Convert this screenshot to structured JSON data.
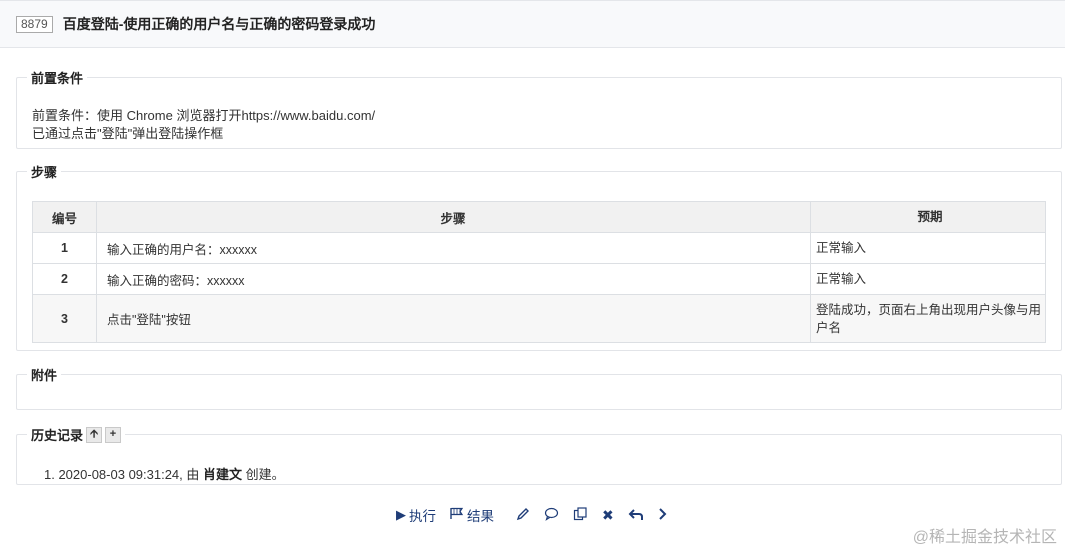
{
  "header": {
    "id": "8879",
    "title": "百度登陆-使用正确的用户名与正确的密码登录成功"
  },
  "preconditions": {
    "legend": "前置条件",
    "line1": "前置条件：使用 Chrome 浏览器打开https://www.baidu.com/",
    "line2": "已通过点击\"登陆\"弹出登陆操作框"
  },
  "steps": {
    "legend": "步骤",
    "headers": {
      "num": "编号",
      "step": "步骤",
      "expect": "预期"
    },
    "rows": [
      {
        "num": "1",
        "step": "输入正确的用户名：xxxxxx",
        "expect": "正常输入"
      },
      {
        "num": "2",
        "step": "输入正确的密码：xxxxxx",
        "expect": "正常输入"
      },
      {
        "num": "3",
        "step": "点击\"登陆\"按钮",
        "expect": "登陆成功，页面右上角出现用户头像与用户名"
      }
    ]
  },
  "attachments": {
    "legend": "附件"
  },
  "history": {
    "legend": "历史记录",
    "item_prefix": "1. 2020-08-03 09:31:24, 由 ",
    "item_user": "肖建文",
    "item_suffix": " 创建。"
  },
  "actions": {
    "execute": "执行",
    "result": "结果"
  },
  "icons": {
    "execute": "play-icon",
    "result": "flag-icon",
    "edit": "pencil-icon",
    "comment": "comment-icon",
    "copy": "copy-icon",
    "delete": "close-icon",
    "back": "back-arrow-icon",
    "next": "chevron-right-icon",
    "history_up": "arrow-up-icon",
    "history_add": "plus-icon"
  },
  "watermark": "@稀土掘金技术社区",
  "colors": {
    "action": "#1f3d78",
    "header_bg": "#f8f9fb",
    "border": "#e2e4e8"
  }
}
